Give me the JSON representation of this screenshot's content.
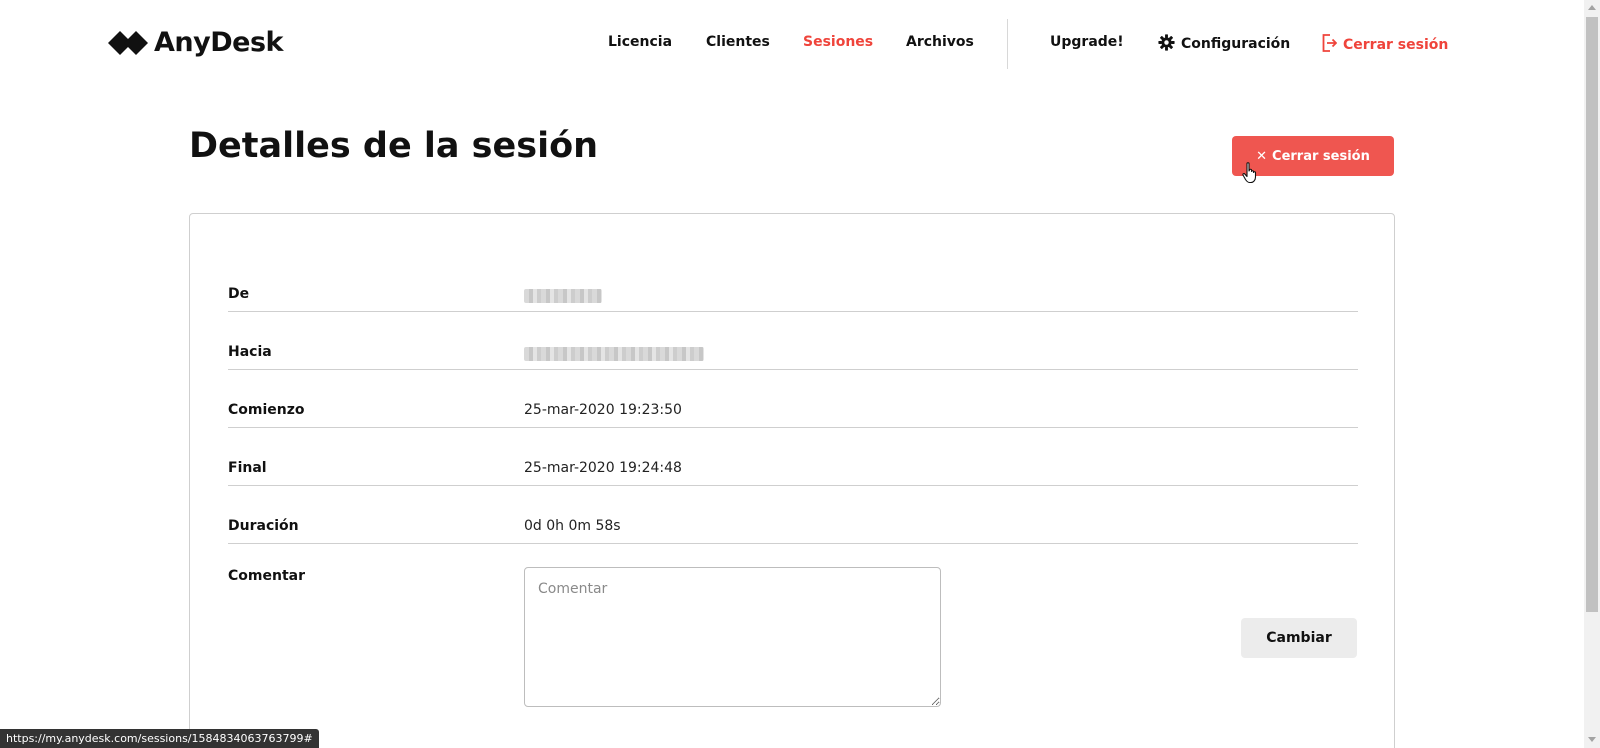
{
  "header": {
    "logo_text": "AnyDesk",
    "nav": [
      {
        "label": "Licencia"
      },
      {
        "label": "Clientes"
      },
      {
        "label": "Sesiones"
      },
      {
        "label": "Archivos"
      },
      {
        "label": "Upgrade!"
      },
      {
        "label": "Configuración"
      },
      {
        "label": "Cerrar sesión"
      }
    ],
    "icons": {
      "settings": "gear-icon",
      "logout": "logout-icon"
    }
  },
  "page": {
    "title": "Detalles de la sesión",
    "end_session_label": "Cerrar sesión"
  },
  "details": {
    "from_label": "De",
    "to_label": "Hacia",
    "start_label": "Comienzo",
    "start_value": "25-mar-2020 19:23:50",
    "end_label": "Final",
    "end_value": "25-mar-2020 19:24:48",
    "duration_label": "Duración",
    "duration_value": "0d 0h 0m 58s",
    "comment_label": "Comentar",
    "comment_placeholder": "Comentar",
    "change_label": "Cambiar"
  },
  "status_url": "https://my.anydesk.com/sessions/1584834063763799#",
  "colors": {
    "accent": "#ef443b",
    "button_red": "#ef5650"
  }
}
